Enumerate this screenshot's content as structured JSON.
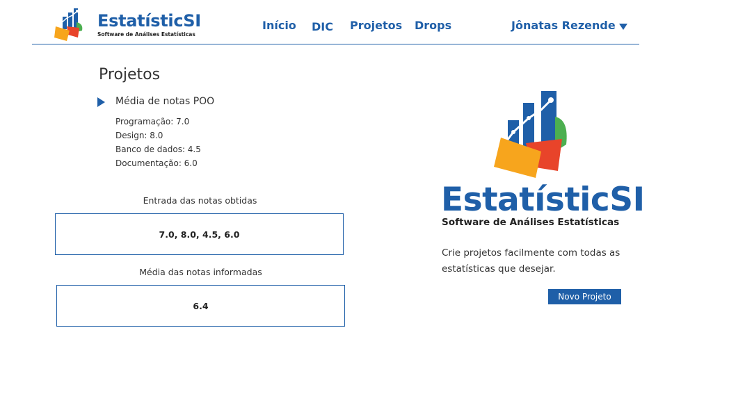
{
  "brand": {
    "name": "EstatísticSI",
    "tagline": "Software de Análises Estatísticas"
  },
  "nav": {
    "items": [
      {
        "label": "Início"
      },
      {
        "label": "DIC"
      },
      {
        "label": "Projetos"
      },
      {
        "label": "Drops"
      }
    ],
    "user": "Jônatas Rezende"
  },
  "page": {
    "title": "Projetos"
  },
  "project": {
    "name": "Média de notas POO",
    "scores": [
      "Programação: 7.0",
      "Design: 8.0",
      "Banco de dados: 4.5",
      "Documentação: 6.0"
    ]
  },
  "inputs": {
    "label": "Entrada das notas obtidas",
    "value": "7.0, 8.0, 4.5, 6.0"
  },
  "average": {
    "label": "Média das notas informadas",
    "value": "6.4"
  },
  "promo": {
    "title": "EstatísticSI",
    "subtitle": "Software de Análises Estatísticas",
    "description": "Crie projetos facilmente com todas as estatísticas que desejar.",
    "button": "Novo Projeto"
  },
  "colors": {
    "primary": "#1f5fa8",
    "orange": "#f7a51d",
    "red": "#e8442a",
    "green": "#4caf50"
  }
}
